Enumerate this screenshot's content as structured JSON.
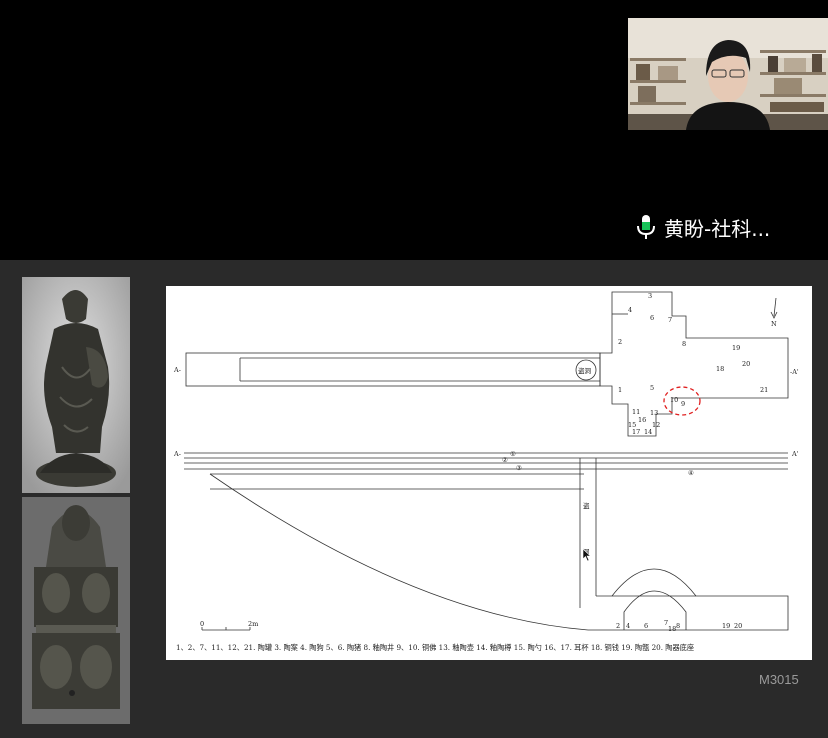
{
  "participant": {
    "name": "黄盼-社科...",
    "mic_color": "#19c35a"
  },
  "slide": {
    "code": "M3015",
    "drawing": {
      "section_a_left": "A-",
      "section_a_right": "-A'",
      "section_a2_left": "A-",
      "section_a2_right": "A'",
      "north": "N",
      "niche_label": "盗洞",
      "shaft_top": "盗",
      "shaft_bottom": "洞",
      "scale_zero": "0",
      "scale_end": "2m",
      "caption": "1、2、7、11、12、21. 陶罐   3. 陶案   4. 陶狗   5、6. 陶猪   8. 釉陶井   9、10. 铜佛   13. 釉陶壶   14. 釉陶樽   15. 陶勺   16、17. 耳杯   18. 铜钱   19. 陶甑   20. 陶器底座",
      "highlight_color": "#e02020",
      "item_numbers": [
        "1",
        "2",
        "3",
        "4",
        "5",
        "6",
        "7",
        "8",
        "9",
        "10",
        "11",
        "12",
        "13",
        "14",
        "15",
        "16",
        "17",
        "18",
        "19",
        "20",
        "21"
      ],
      "bottom_numbers": [
        "2",
        "4",
        "6",
        "7",
        "8",
        "18",
        "19",
        "20"
      ],
      "fill_numbers": [
        "①",
        "②",
        "③",
        "④"
      ]
    }
  }
}
